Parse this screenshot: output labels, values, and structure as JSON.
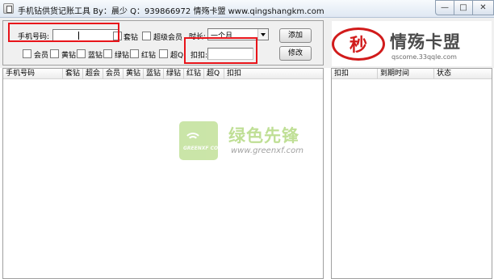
{
  "window": {
    "title": "手机钻供货记账工具 By：晨少 Q：939866972 情殇卡盟 www.qingshangkm.com",
    "min_glyph": "—",
    "max_glyph": "□",
    "close_glyph": "✕"
  },
  "form": {
    "phone_label": "手机号码:",
    "phone_value": "",
    "checks_row1": [
      {
        "label": "套钻",
        "checked": false
      },
      {
        "label": "超级会员",
        "checked": false
      }
    ],
    "checks_row2": [
      {
        "label": "会员",
        "checked": false
      },
      {
        "label": "黄钻",
        "checked": false
      },
      {
        "label": "蓝钻",
        "checked": false
      },
      {
        "label": "绿钻",
        "checked": false
      },
      {
        "label": "红钻",
        "checked": false
      },
      {
        "label": "超Q",
        "checked": false
      }
    ],
    "duration_label": "时长:",
    "duration_value": "一个月",
    "deduct_label": "扣扣:",
    "deduct_value": "",
    "add_button": "添加",
    "modify_button": "修改"
  },
  "logo": {
    "seal_char": "秒",
    "brand": "情殇卡盟",
    "url": "qscome.33qqle.com"
  },
  "left_table": {
    "columns": [
      "手机号码",
      "套钻",
      "超会",
      "会员",
      "黄钻",
      "蓝钻",
      "绿钻",
      "红钻",
      "超Q",
      "扣扣"
    ],
    "rows": []
  },
  "right_table": {
    "columns": [
      "扣扣",
      "到期时间",
      "状态"
    ],
    "rows": []
  },
  "watermark": {
    "text": "绿色先锋",
    "url": "www.greenxf.com",
    "badge": "GREENXF COM"
  },
  "colors": {
    "highlight": "#e8141a",
    "logo_red": "#d11b1b",
    "watermark_green": "#8cc63f"
  }
}
